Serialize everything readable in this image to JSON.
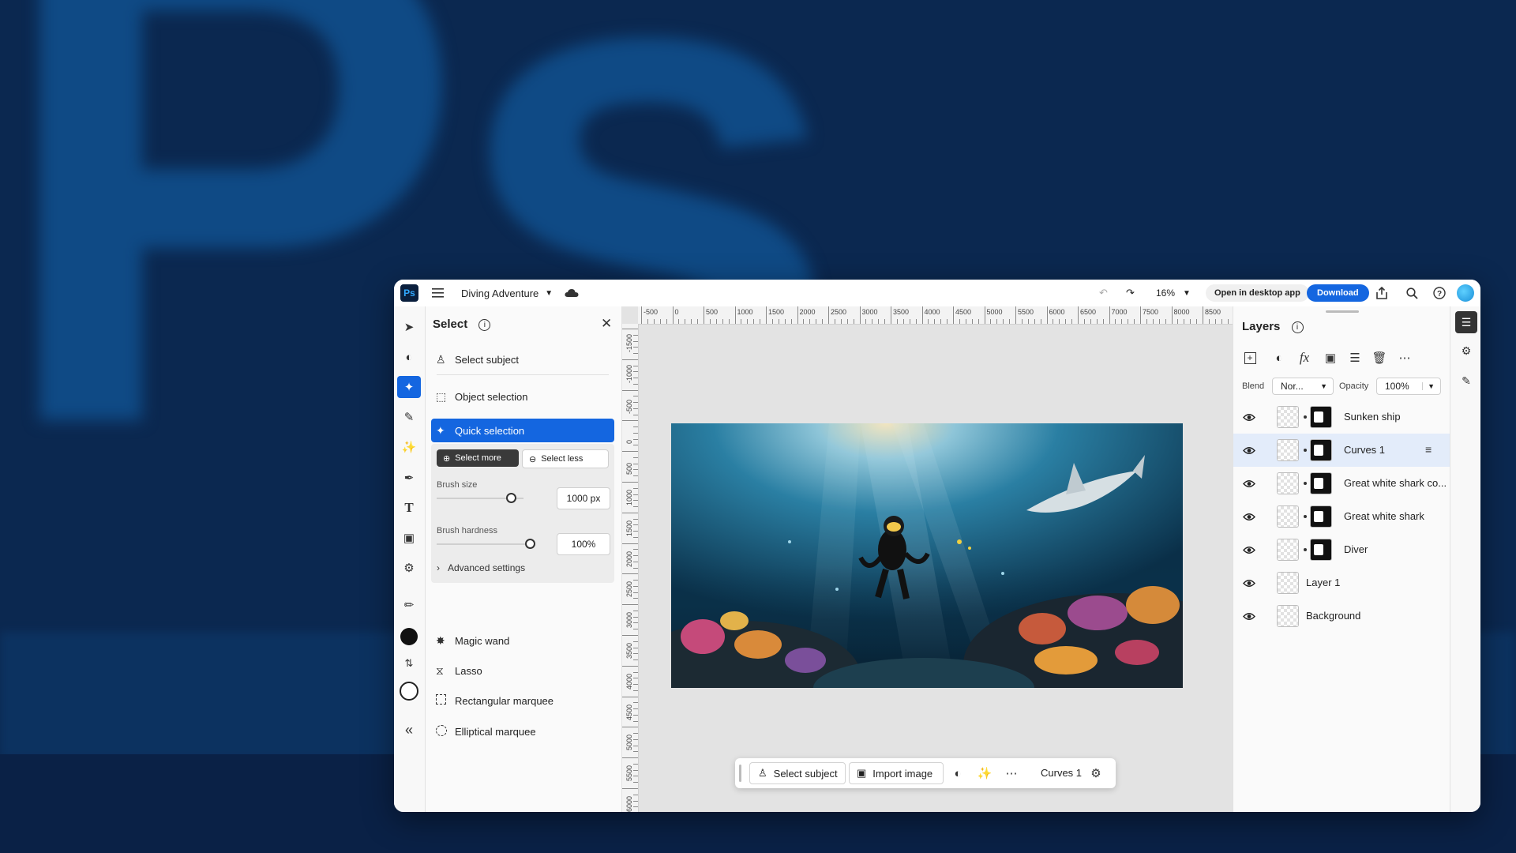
{
  "background": {
    "wordmark": "Ps"
  },
  "topbar": {
    "logo": "Ps",
    "doc_title": "Diving Adventure",
    "zoom": "16%",
    "open_desktop": "Open in desktop app",
    "download": "Download"
  },
  "select_panel": {
    "title": "Select",
    "items": [
      {
        "label": "Select subject",
        "icon": "person-icon"
      },
      {
        "label": "Object selection",
        "icon": "object-selection-icon"
      },
      {
        "label": "Quick selection",
        "icon": "quick-selection-icon",
        "active": true
      },
      {
        "label": "Magic wand",
        "icon": "magic-wand-icon"
      },
      {
        "label": "Lasso",
        "icon": "lasso-icon"
      },
      {
        "label": "Rectangular marquee",
        "icon": "rect-marquee-icon"
      },
      {
        "label": "Elliptical marquee",
        "icon": "ellipse-marquee-icon"
      }
    ],
    "select_more": "Select more",
    "select_less": "Select less",
    "brush_size_label": "Brush size",
    "brush_size": "1000 px",
    "brush_size_level": 0.85,
    "brush_hardness_label": "Brush hardness",
    "brush_hardness": "100%",
    "brush_hardness_level": 1.0,
    "advanced": "Advanced settings"
  },
  "ruler": {
    "top": [
      "-500",
      "0",
      "500",
      "1000",
      "1500",
      "2000",
      "2500",
      "3000",
      "3500",
      "4000",
      "4500",
      "5000",
      "5500",
      "6000",
      "6500",
      "7000",
      "7500",
      "8000",
      "8500"
    ],
    "left": [
      "-1500",
      "-1000",
      "-500",
      "0",
      "500",
      "1000",
      "1500",
      "2000",
      "2500",
      "3000",
      "3500",
      "4000",
      "4500",
      "5000",
      "5500",
      "6000"
    ]
  },
  "bottom_bar": {
    "select_subject": "Select subject",
    "import_image": "Import image",
    "layer": "Curves 1"
  },
  "layers_panel": {
    "title": "Layers",
    "blend_label": "Blend",
    "blend_value": "Nor...",
    "opacity_label": "Opacity",
    "opacity_value": "100%",
    "layers": [
      {
        "name": "Sunken ship",
        "selected": false
      },
      {
        "name": "Curves 1",
        "selected": true
      },
      {
        "name": "Great white shark co...",
        "selected": false
      },
      {
        "name": "Great white shark",
        "selected": false
      },
      {
        "name": "Diver",
        "selected": false
      },
      {
        "name": "Layer 1",
        "selected": false
      },
      {
        "name": "Background",
        "selected": false
      }
    ]
  }
}
